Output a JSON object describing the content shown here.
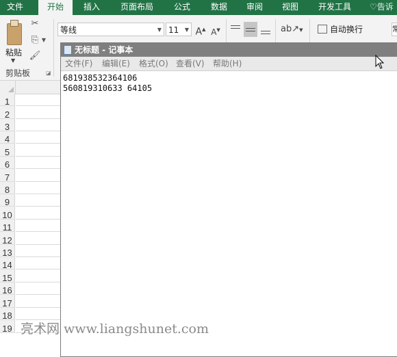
{
  "ribbon_tabs": [
    "文件",
    "开始",
    "插入",
    "页面布局",
    "公式",
    "数据",
    "审阅",
    "视图",
    "开发工具"
  ],
  "tell_me": "告诉",
  "clipboard": {
    "paste_label": "粘贴",
    "group_label": "剪贴板"
  },
  "font": {
    "name": "等线",
    "size": "11"
  },
  "wrap_text_label": "自动换行",
  "right_box_text": "常",
  "row_numbers": [
    "1",
    "2",
    "3",
    "4",
    "5",
    "6",
    "7",
    "8",
    "9",
    "10",
    "11",
    "12",
    "13",
    "14",
    "15",
    "16",
    "17",
    "18",
    "19"
  ],
  "notepad": {
    "title": "无标题 - 记事本",
    "menu": [
      "文件(F)",
      "编辑(E)",
      "格式(O)",
      "查看(V)",
      "帮助(H)"
    ],
    "lines": [
      "681938532364106",
      "560819310633 64105"
    ]
  },
  "watermark": "亮术网 www.liangshunet.com"
}
